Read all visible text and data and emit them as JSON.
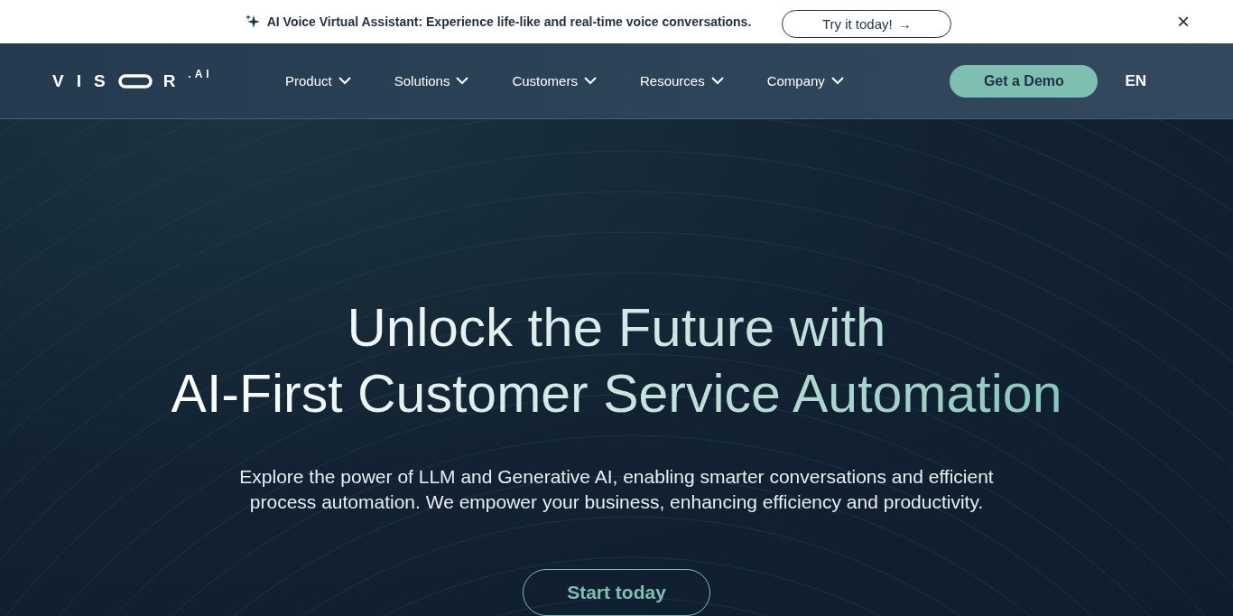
{
  "announcement": {
    "text": "AI Voice Virtual Assistant: Experience life-like and real-time voice conversations.",
    "button": "Try it today!",
    "arrow": "→",
    "close": "×"
  },
  "logo": {
    "before": "VIS",
    "after": "R",
    "suffix": ".AI"
  },
  "nav": {
    "items": [
      {
        "label": "Product",
        "has_menu": true
      },
      {
        "label": "Solutions",
        "has_menu": true
      },
      {
        "label": "Customers",
        "has_menu": true
      },
      {
        "label": "Resources",
        "has_menu": true
      },
      {
        "label": "Company",
        "has_menu": true
      }
    ],
    "cta": "Get a Demo",
    "language": "EN"
  },
  "hero": {
    "title_line_1": "Unlock the Future with",
    "title_line_2": "AI-First Customer Service Automation",
    "text": "Explore the power of LLM and Generative AI, enabling smarter conversations and efficient process automation. We empower your business, enhancing efficiency and productivity.",
    "button": "Start today"
  }
}
